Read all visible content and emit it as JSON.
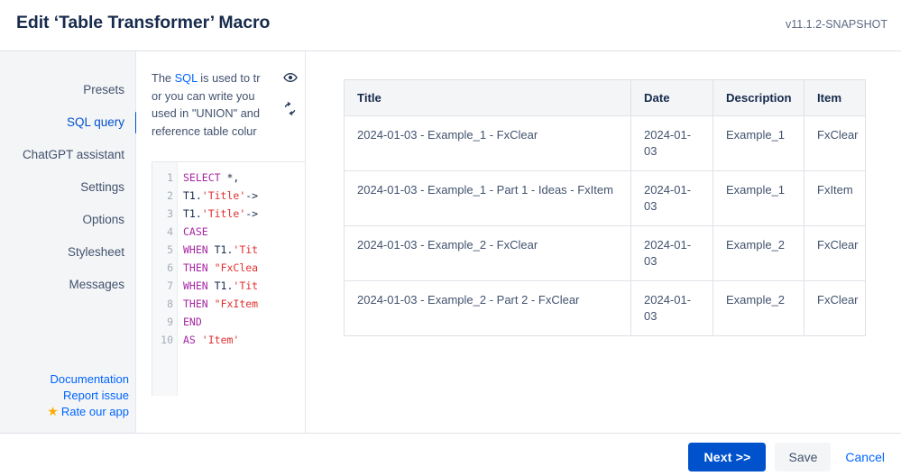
{
  "header": {
    "title": "Edit ‘Table Transformer’ Macro",
    "version": "v11.1.2-SNAPSHOT"
  },
  "sidebar": {
    "items": [
      {
        "label": "Presets",
        "active": false
      },
      {
        "label": "SQL query",
        "active": true
      },
      {
        "label": "ChatGPT assistant",
        "active": false
      },
      {
        "label": "Settings",
        "active": false
      },
      {
        "label": "Options",
        "active": false
      },
      {
        "label": "Stylesheet",
        "active": false
      },
      {
        "label": "Messages",
        "active": false
      }
    ],
    "links": [
      {
        "label": "Documentation"
      },
      {
        "label": "Report issue"
      },
      {
        "label": "Rate our app",
        "icon": "star-icon"
      }
    ]
  },
  "editor": {
    "description": {
      "line1_pre": "The ",
      "line1_kw": "SQL",
      "line1_post": " is used to tr",
      "line2": "or you can write you",
      "line3": "used in \"UNION\" and",
      "line4": "reference table colur"
    },
    "icons": [
      {
        "name": "eye-icon",
        "title": "Preview"
      },
      {
        "name": "refresh-icon",
        "title": "Refresh"
      }
    ],
    "code_lines": [
      {
        "n": "1",
        "segments": [
          {
            "t": "SELECT",
            "c": "tok-kw"
          },
          {
            "t": " *,",
            "c": "tok-pl"
          }
        ]
      },
      {
        "n": "2",
        "segments": [
          {
            "t": "T1.",
            "c": "tok-pl"
          },
          {
            "t": "'Title'",
            "c": "tok-str"
          },
          {
            "t": "->",
            "c": "tok-pl"
          }
        ]
      },
      {
        "n": "3",
        "segments": [
          {
            "t": "T1.",
            "c": "tok-pl"
          },
          {
            "t": "'Title'",
            "c": "tok-str"
          },
          {
            "t": "->",
            "c": "tok-pl"
          }
        ]
      },
      {
        "n": "4",
        "segments": [
          {
            "t": "CASE",
            "c": "tok-kw"
          }
        ]
      },
      {
        "n": "5",
        "segments": [
          {
            "t": "WHEN",
            "c": "tok-kw"
          },
          {
            "t": " T1.",
            "c": "tok-pl"
          },
          {
            "t": "'Tit",
            "c": "tok-str"
          }
        ]
      },
      {
        "n": "6",
        "segments": [
          {
            "t": "THEN",
            "c": "tok-kw"
          },
          {
            "t": " ",
            "c": "tok-pl"
          },
          {
            "t": "\"FxClea",
            "c": "tok-str"
          }
        ]
      },
      {
        "n": "7",
        "segments": [
          {
            "t": "WHEN",
            "c": "tok-kw"
          },
          {
            "t": " T1.",
            "c": "tok-pl"
          },
          {
            "t": "'Tit",
            "c": "tok-str"
          }
        ]
      },
      {
        "n": "8",
        "segments": [
          {
            "t": "THEN",
            "c": "tok-kw"
          },
          {
            "t": " ",
            "c": "tok-pl"
          },
          {
            "t": "\"FxItem",
            "c": "tok-str"
          }
        ]
      },
      {
        "n": "9",
        "segments": [
          {
            "t": "END",
            "c": "tok-kw"
          }
        ]
      },
      {
        "n": "10",
        "segments": [
          {
            "t": "AS",
            "c": "tok-kw"
          },
          {
            "t": " ",
            "c": "tok-pl"
          },
          {
            "t": "'Item'",
            "c": "tok-str"
          }
        ]
      }
    ]
  },
  "result": {
    "columns": [
      "Title",
      "Date",
      "Description",
      "Item"
    ],
    "rows": [
      [
        "2024-01-03 - Example_1 - FxClear",
        "2024-01-03",
        "Example_1",
        "FxClear"
      ],
      [
        "2024-01-03 - Example_1 - Part 1 - Ideas - FxItem",
        "2024-01-03",
        "Example_1",
        "FxItem"
      ],
      [
        "2024-01-03 - Example_2 - FxClear",
        "2024-01-03",
        "Example_2",
        "FxClear"
      ],
      [
        "2024-01-03 - Example_2 - Part 2 - FxClear",
        "2024-01-03",
        "Example_2",
        "FxClear"
      ]
    ]
  },
  "footer": {
    "next_label": "Next >>",
    "save_label": "Save",
    "cancel_label": "Cancel"
  },
  "colors": {
    "accent": "#0052cc",
    "link": "#0065ff",
    "text": "#42526e",
    "heading": "#172b4d",
    "panel_bg": "#f4f5f7",
    "border": "#dfe1e6",
    "star": "#ffab00",
    "code_keyword": "#a626a4",
    "code_string": "#e03030"
  }
}
